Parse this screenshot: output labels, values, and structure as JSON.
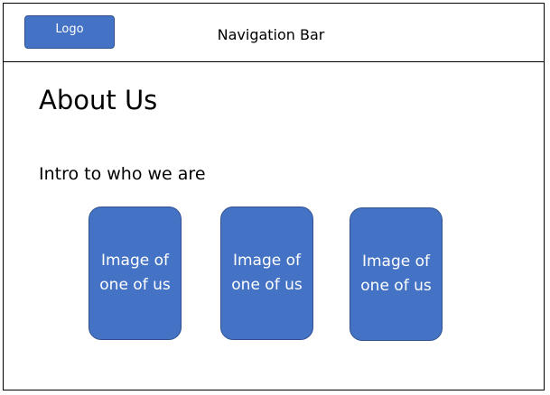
{
  "header": {
    "logo_label": "Logo",
    "nav_title": "Navigation Bar"
  },
  "main": {
    "title": "About Us",
    "intro": "Intro to who we are",
    "cards": [
      {
        "label": "Image of one of us"
      },
      {
        "label": "Image of one of us"
      },
      {
        "label": "Image of one of us"
      }
    ]
  },
  "colors": {
    "accent": "#4472c4",
    "accent_border": "#2f528f"
  }
}
